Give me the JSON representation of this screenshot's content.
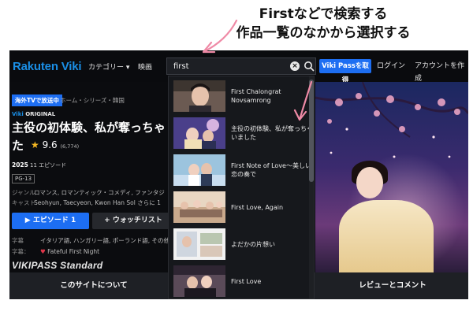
{
  "callout": {
    "line1": "Firstなどで検索する",
    "line2": "作品一覧のなかから選択する"
  },
  "nav": {
    "logo": "Rakuten Viki",
    "categories": "カテゴリー ▾",
    "movies": "映画",
    "viki_pass": "Viki Passを取得",
    "login": "ログイン",
    "signup": "アカウントを作成"
  },
  "search": {
    "value": "first",
    "clear": "×"
  },
  "results": [
    {
      "title": "First Chalongrat Novsamrong"
    },
    {
      "title": "主役の初体験、私が奪っちゃいました"
    },
    {
      "title": "First Note of Love〜美しい恋の奏で"
    },
    {
      "title": "First Love, Again"
    },
    {
      "title": "よだかの片想い"
    },
    {
      "title": "First Love"
    }
  ],
  "show": {
    "badge": "海外TVで放送中",
    "breadcrumb": "ホーム・シリーズ・韓国",
    "original_brand": "Viki",
    "original_label": "ORIGINAL",
    "title_line1": "主役の初体験、私が奪っちゃ",
    "title_line2": "た",
    "rating": "9.6",
    "rating_count": "(6,774)",
    "year": "2025",
    "episodes": "11 エピソード",
    "pg": "PG-13",
    "genre_label": "ジャンル",
    "genre": "ロマンス, ロマンティック・コメディ, ファンタジ",
    "cast_label": "キャスト",
    "cast": "Seohyun, Taecyeon, Kwon Han Sol さらに 1",
    "episode_button": "▶ エピソード 1",
    "watchlist_button": "+ ウォッチリスト",
    "subs_label": "字幕",
    "subs": "イタリア語, ハンガリー語, ポーランド語, その他",
    "subteam_label": "字幕：",
    "subteam": "Fateful First Night",
    "vikipass": "VIKIPASS Standard"
  },
  "tabs": {
    "about": "このサイトについて",
    "reviews": "レビューとコメント"
  },
  "colors": {
    "accent": "#1d6ef2",
    "logo": "#1a8fe6",
    "star": "#f3b623"
  }
}
